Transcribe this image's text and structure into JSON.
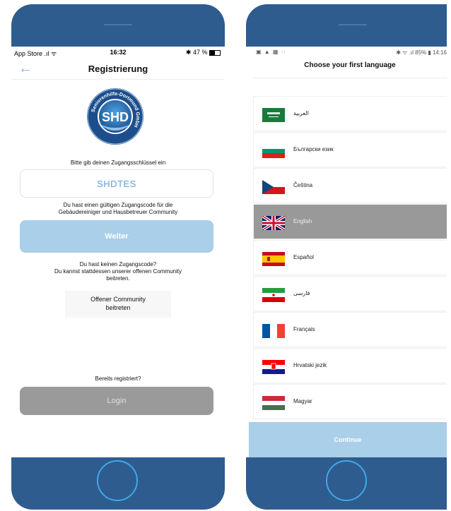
{
  "left": {
    "status": {
      "carrier": "App Store",
      "time": "16:32",
      "battery": "47 %"
    },
    "nav": {
      "back": "←",
      "title": "Registrierung"
    },
    "logo": {
      "ring_text": "Seniorenhilfe-Dortmund GmbH",
      "center_text": "SHD"
    },
    "prompt": "Bitte gib deinen Zugangsschlüssel ein",
    "code_value": "SHDTES",
    "info_line1": "Du hast einen gültigen Zugangscode für die",
    "info_line2": "Gebäudereiniger und Hausbetreuer Community",
    "weiter_label": "Weiter",
    "no_code_line1": "Du hast keinen Zugangscode?",
    "no_code_line2": "Du kannst stattdessen unserer offenen Community",
    "no_code_line3": "beitreten.",
    "open_line1": "Offener Community",
    "open_line2": "beitreten",
    "already_label": "Bereits registriert?",
    "login_label": "Login"
  },
  "right": {
    "status": {
      "left_icons": "▣ ▲ ▦ ··",
      "right": "✱ ᯤ .ıl 85% ▮ 14:16"
    },
    "title": "Choose your first language",
    "languages": [
      {
        "name": "العربية",
        "flag": "saudi-arabia-flag"
      },
      {
        "name": "Български език",
        "flag": "bulgaria-flag"
      },
      {
        "name": "Čeština",
        "flag": "czech-flag"
      },
      {
        "name": "English",
        "flag": "uk-flag",
        "selected": true
      },
      {
        "name": "Español",
        "flag": "spain-flag"
      },
      {
        "name": "فارسی",
        "flag": "iran-flag"
      },
      {
        "name": "Français",
        "flag": "france-flag"
      },
      {
        "name": "Hrvatski jezik",
        "flag": "croatia-flag"
      },
      {
        "name": "Magyar",
        "flag": "hungary-flag"
      }
    ],
    "continue_label": "Continue"
  },
  "colors": {
    "frame": "#2e5c8e",
    "accent": "#a9cfe9",
    "link": "#5c9fd9",
    "selected_row": "#999999",
    "home_ring": "#3fa9e6"
  }
}
